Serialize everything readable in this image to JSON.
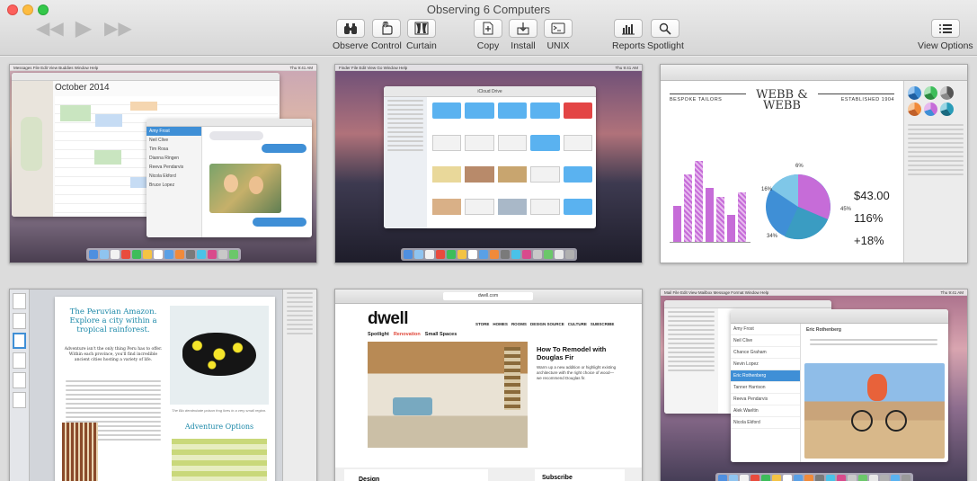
{
  "window": {
    "title": "Observing 6 Computers"
  },
  "playback": {
    "rewind_icon": "rewind-icon",
    "play_icon": "play-icon",
    "forward_icon": "fast-forward-icon"
  },
  "toolbar": {
    "observe": "Observe",
    "control": "Control",
    "curtain": "Curtain",
    "copy": "Copy",
    "install": "Install",
    "unix": "UNIX",
    "reports": "Reports",
    "spotlight": "Spotlight",
    "view_options": "View Options"
  },
  "screens": {
    "s1": {
      "calendar_month": "October 2014",
      "menubar": "Messages  File  Edit  View  Buddies  Window  Help",
      "clock": "Thu 9:41 AM",
      "chat_1": "Amy Frost",
      "chat_2": "Neil Clive",
      "chat_3": "Tim Rosa",
      "chat_4": "Dianna Ringen",
      "chat_5": "Reeva Pendarvis",
      "chat_6": "Nicola Ekford",
      "chat_7": "Bruce Lopez"
    },
    "s2": {
      "finder_title": "iCloud Drive",
      "menubar": "Finder  File  Edit  View  Go  Window  Help",
      "clock": "Thu 9:41 AM",
      "files": [
        "Keynote",
        "Numbers",
        "Pages",
        "TextEdit",
        "QuickTime Player"
      ]
    },
    "s3": {
      "logo": "WEBB & WEBB",
      "tagline_left": "BESPOKE TAILORS",
      "tagline_right": "ESTABLISHED 1904",
      "value_1": "$43.00",
      "value_2": "116%",
      "value_3": "+18%",
      "pie_labels": [
        "6%",
        "16%",
        "45%",
        "34%"
      ]
    },
    "s4": {
      "title": "The Peruvian Amazon. Explore a city within a tropical rainforest.",
      "body": "Adventure isn't the only thing Peru has to offer. Within each province, you'll find incredible ancient cities hosting a variety of life.",
      "section": "Adventure Options",
      "caption": "The Blu dendrobate poison frog lives in a very small region."
    },
    "s5": {
      "logo": "dwell",
      "nav": [
        "STORE",
        "HOMES",
        "ROOMS",
        "DESIGN SOURCE",
        "CULTURE",
        "SUBSCRIBE"
      ],
      "sub_nav": [
        "Spotlight",
        "Renovation",
        "Small Spaces"
      ],
      "headline": "How To Remodel with Douglas Fir",
      "teaser": "Warm up a new addition or highlight existing architecture with the right choice of wood—we recommend Douglas fir.",
      "url": "dwell.com",
      "footer_left": "Design",
      "footer_right": "Subscribe"
    },
    "s6": {
      "menubar": "Mail  File  Edit  View  Mailbox  Message  Format  Window  Help",
      "clock": "Thu 9:41 AM",
      "sender": "Eric Rothenberg",
      "mail_items": [
        "Amy Frost",
        "Neil Clive",
        "Chance Graham",
        "Nevin Lopez",
        "Eric Rothenberg",
        "Tanner Harrison",
        "Reeva Pendarvis",
        "Alek Waeltin",
        "Nicola Ekford"
      ]
    }
  },
  "colors": {
    "titlebar_top": "#ebebeb",
    "titlebar_bottom": "#d6d6d6",
    "grid_bg": "#dcdcdc",
    "accent_purple": "#c66cd8",
    "accent_blue": "#3f8fd6"
  }
}
